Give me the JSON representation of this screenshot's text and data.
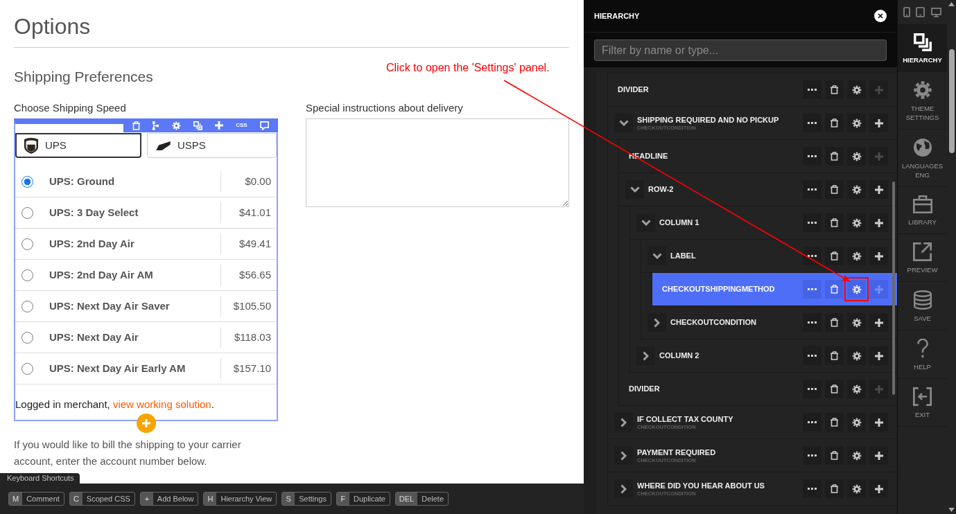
{
  "canvas": {
    "title": "Options",
    "section": "Shipping Preferences",
    "shipping": {
      "label": "Choose Shipping Speed",
      "carriers": [
        {
          "name": "UPS",
          "kind": "ups",
          "selected": true
        },
        {
          "name": "USPS",
          "kind": "usps",
          "selected": false
        }
      ],
      "toolbar": {
        "css_label": "CSS"
      },
      "methods": [
        {
          "name": "UPS: Ground",
          "price": "$0.00",
          "selected": true
        },
        {
          "name": "UPS: 3 Day Select",
          "price": "$41.01",
          "selected": false
        },
        {
          "name": "UPS: 2nd Day Air",
          "price": "$49.41",
          "selected": false
        },
        {
          "name": "UPS: 2nd Day Air AM",
          "price": "$56.65",
          "selected": false
        },
        {
          "name": "UPS: Next Day Air Saver",
          "price": "$105.50",
          "selected": false
        },
        {
          "name": "UPS: Next Day Air",
          "price": "$118.03",
          "selected": false
        },
        {
          "name": "UPS: Next Day Air Early AM",
          "price": "$157.10",
          "selected": false
        }
      ],
      "note": {
        "before": "Logged in merchant, ",
        "link": "view working solution",
        "after": "."
      },
      "billing_text": "If you would like to bill the shipping to your carrier account, enter the account number below."
    },
    "instructions": {
      "label": "Special instructions about delivery"
    }
  },
  "annotation": {
    "text": "Click to open the 'Settings' panel."
  },
  "keyboard_shortcuts": {
    "title": "Keyboard Shortcuts",
    "items": [
      {
        "key": "M",
        "label": "Comment"
      },
      {
        "key": "C",
        "label": "Scoped CSS"
      },
      {
        "key": "+",
        "label": "Add Below"
      },
      {
        "key": "H",
        "label": "Hierarchy View"
      },
      {
        "key": "S",
        "label": "Settings"
      },
      {
        "key": "F",
        "label": "Duplicate"
      },
      {
        "key": "DEL",
        "label": "Delete"
      }
    ]
  },
  "hierarchy": {
    "title": "HIERARCHY",
    "filter": {
      "placeholder": "Filter by name or type..."
    },
    "items": [
      {
        "title": "DIVIDER",
        "selected": false,
        "add_disabled": true
      },
      {
        "title": "SHIPPING REQUIRED AND NO PICKUP",
        "type": "CHECKOUTCONDITION",
        "expanded": true,
        "selected": false,
        "add_disabled": false,
        "children": [
          {
            "title": "HEADLINE",
            "selected": false,
            "add_disabled": true
          },
          {
            "title": "ROW-2",
            "expanded": true,
            "selected": false,
            "add_disabled": false,
            "children": [
              {
                "title": "COLUMN 1",
                "expanded": true,
                "selected": false,
                "add_disabled": false,
                "children": [
                  {
                    "title": "LABEL",
                    "expanded": true,
                    "selected": false,
                    "add_disabled": false,
                    "children": [
                      {
                        "title": "CHECKOUTSHIPPINGMETHOD",
                        "selected": true,
                        "add_disabled": true
                      }
                    ]
                  },
                  {
                    "title": "CHECKOUTCONDITION",
                    "expanded": false,
                    "selected": false,
                    "add_disabled": false
                  }
                ]
              },
              {
                "title": "COLUMN 2",
                "expanded": false,
                "selected": false,
                "add_disabled": false
              }
            ]
          },
          {
            "title": "DIVIDER",
            "selected": false,
            "add_disabled": true
          }
        ]
      },
      {
        "title": "IF COLLECT TAX COUNTY",
        "type": "CHECKOUTCONDITION",
        "expanded": false,
        "selected": false,
        "add_disabled": false
      },
      {
        "title": "PAYMENT REQUIRED",
        "type": "CHECKOUTCONDITION",
        "expanded": false,
        "selected": false,
        "add_disabled": false
      },
      {
        "title": "WHERE DID YOU HEAR ABOUT US",
        "type": "CHECKOUTCONDITION",
        "expanded": false,
        "selected": false,
        "add_disabled": false
      }
    ]
  },
  "sidebar": {
    "items": [
      {
        "label": "HIERARCHY",
        "kind": "hierarchy",
        "selected": true
      },
      {
        "label": "THEME SETTINGS",
        "kind": "theme",
        "selected": false
      },
      {
        "label": "LANGUAGES",
        "sublabel": "ENG",
        "kind": "languages",
        "selected": false
      },
      {
        "label": "LIBRARY",
        "kind": "library",
        "selected": false
      },
      {
        "label": "PREVIEW",
        "kind": "preview",
        "selected": false
      },
      {
        "label": "SAVE",
        "kind": "save",
        "selected": false
      },
      {
        "label": "HELP",
        "kind": "help",
        "selected": false
      },
      {
        "label": "EXIT",
        "kind": "exit",
        "selected": false
      }
    ]
  }
}
